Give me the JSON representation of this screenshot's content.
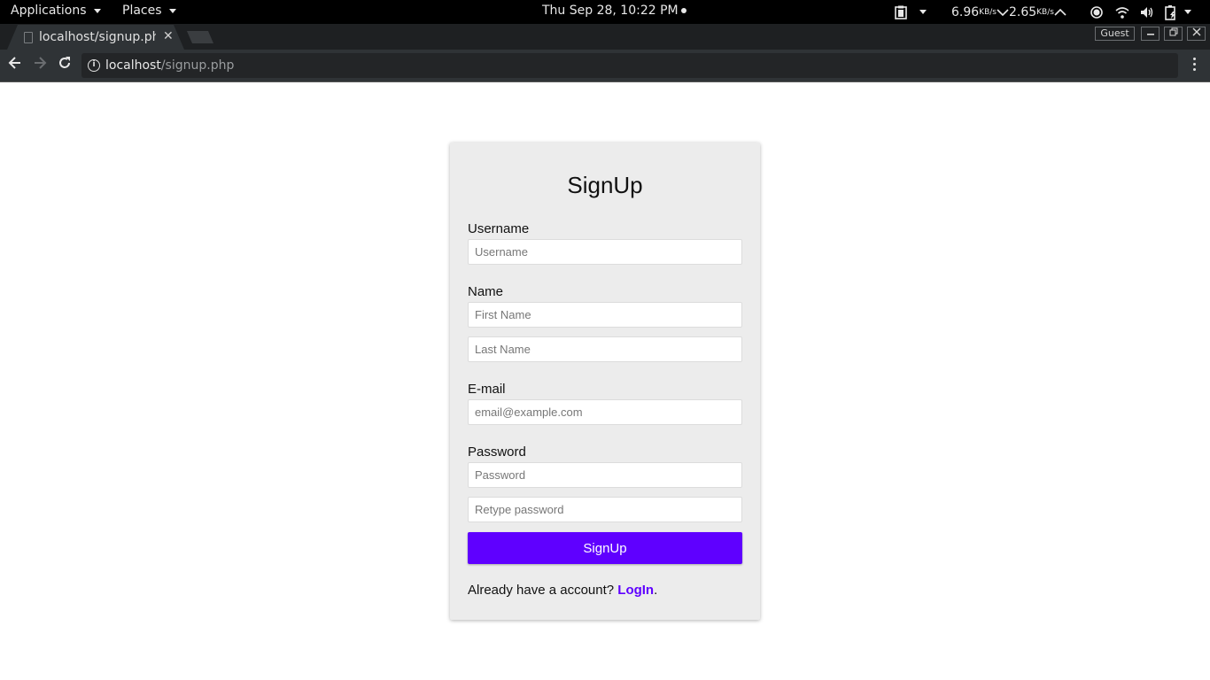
{
  "system_bar": {
    "applications_label": "Applications",
    "places_label": "Places",
    "clock": "Thu Sep 28, 10:22 PM",
    "net_down_value": "6.96",
    "net_down_unit": "KB/s",
    "net_up_value": "2.65",
    "net_up_unit": "KB/s",
    "tray_icons": [
      "clipboard-icon",
      "record-icon",
      "wifi-icon",
      "volume-icon",
      "battery-charging-icon"
    ]
  },
  "browser": {
    "tab_title": "localhost/signup.php",
    "profile_label": "Guest",
    "url_host": "localhost",
    "url_path": "/signup.php",
    "window_buttons": {
      "minimize": "—",
      "restore": "⧉",
      "close": "✕"
    }
  },
  "signup_form": {
    "title": "SignUp",
    "username_label": "Username",
    "username_placeholder": "Username",
    "name_label": "Name",
    "first_name_placeholder": "First Name",
    "last_name_placeholder": "Last Name",
    "email_label": "E-mail",
    "email_placeholder": "email@example.com",
    "password_label": "Password",
    "password_placeholder": "Password",
    "retype_password_placeholder": "Retype password",
    "submit_label": "SignUp",
    "footer_text": "Already have a account? ",
    "login_link": "LogIn",
    "footer_period": ".",
    "accent_color": "#5f00ff"
  }
}
